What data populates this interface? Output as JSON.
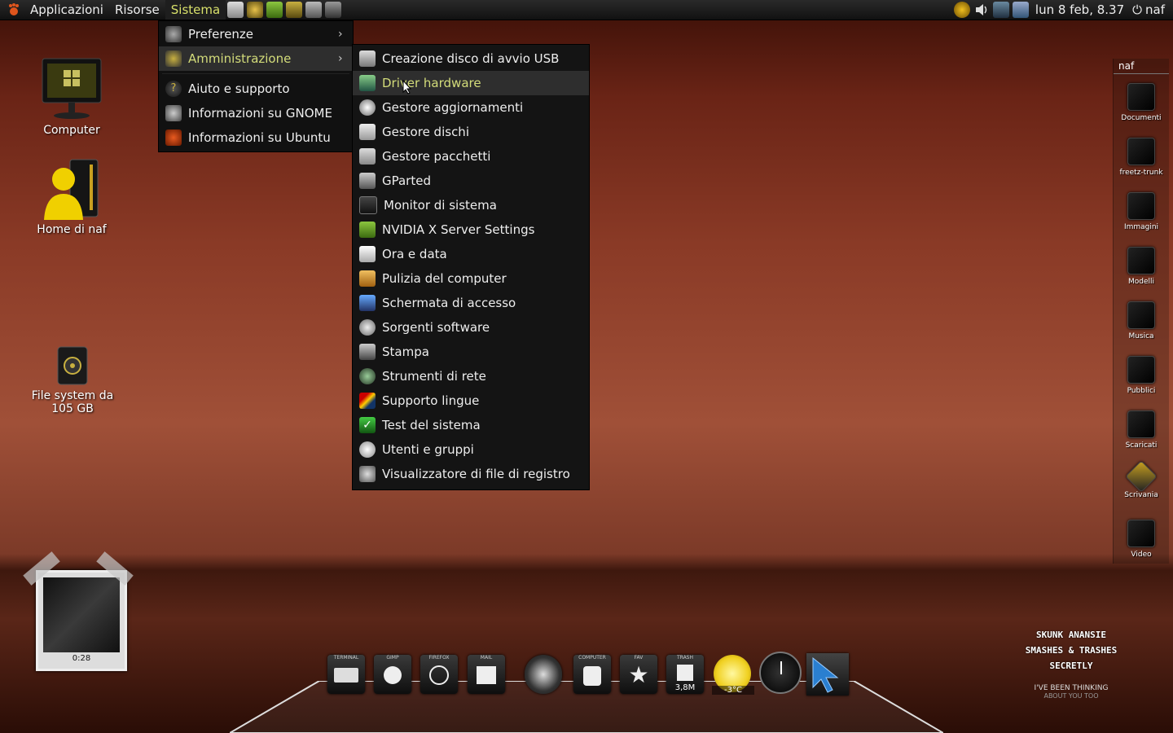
{
  "panel": {
    "menus": [
      "Applicazioni",
      "Risorse",
      "Sistema"
    ],
    "clock": "lun 8 feb, 8.37",
    "user": "naf"
  },
  "system_menu": {
    "items": [
      {
        "label": "Preferenze",
        "icon": "preferences-icon",
        "submenu": true
      },
      {
        "label": "Amministrazione",
        "icon": "administration-icon",
        "submenu": true
      },
      {
        "label": "Aiuto e supporto",
        "icon": "help-icon"
      },
      {
        "label": "Informazioni su GNOME",
        "icon": "gnome-foot-icon"
      },
      {
        "label": "Informazioni su Ubuntu",
        "icon": "ubuntu-icon"
      }
    ]
  },
  "admin_menu": {
    "items": [
      {
        "label": "Creazione disco di avvio USB",
        "icon": "usb-disk-icon"
      },
      {
        "label": "Driver hardware",
        "icon": "hardware-card-icon"
      },
      {
        "label": "Gestore aggiornamenti",
        "icon": "update-icon"
      },
      {
        "label": "Gestore dischi",
        "icon": "disk-icon"
      },
      {
        "label": "Gestore pacchetti",
        "icon": "package-icon"
      },
      {
        "label": "GParted",
        "icon": "gparted-icon"
      },
      {
        "label": "Monitor di sistema",
        "icon": "monitor-icon"
      },
      {
        "label": "NVIDIA X Server Settings",
        "icon": "nvidia-icon"
      },
      {
        "label": "Ora e data",
        "icon": "calendar-icon"
      },
      {
        "label": "Pulizia del computer",
        "icon": "broom-icon"
      },
      {
        "label": "Schermata di accesso",
        "icon": "login-screen-icon"
      },
      {
        "label": "Sorgenti software",
        "icon": "software-sources-icon"
      },
      {
        "label": "Stampa",
        "icon": "printer-icon"
      },
      {
        "label": "Strumenti di rete",
        "icon": "network-icon"
      },
      {
        "label": "Supporto lingue",
        "icon": "flag-icon"
      },
      {
        "label": "Test del sistema",
        "icon": "checkmark-icon"
      },
      {
        "label": "Utenti e gruppi",
        "icon": "users-icon"
      },
      {
        "label": "Visualizzatore di file di registro",
        "icon": "log-viewer-icon"
      }
    ]
  },
  "desktop_icons": {
    "computer": "Computer",
    "home": "Home di naf",
    "filesystem_line1": "File system da",
    "filesystem_line2": "105 GB"
  },
  "places": {
    "title": "naf",
    "items": [
      "Documenti",
      "freetz-trunk",
      "Immagini",
      "Modelli",
      "Musica",
      "Pubblici",
      "Scaricati",
      "Scrivania",
      "Video"
    ]
  },
  "photo_widget": {
    "caption": "0:28"
  },
  "dock": {
    "labels": [
      "TERMINAL",
      "GIMP",
      "FIREFOX",
      "MAIL",
      "",
      "COMPUTER",
      "FAV",
      "TRASH"
    ],
    "trash_size": "3,8M",
    "weather_temp": "-3°C"
  },
  "quote": {
    "line1": "SKUNK ANANSIE",
    "line2": "SMASHES & TRASHES",
    "line3": "SECRETLY",
    "line4": "I'VE BEEN THINKING",
    "line5": "ABOUT YOU TOO"
  }
}
